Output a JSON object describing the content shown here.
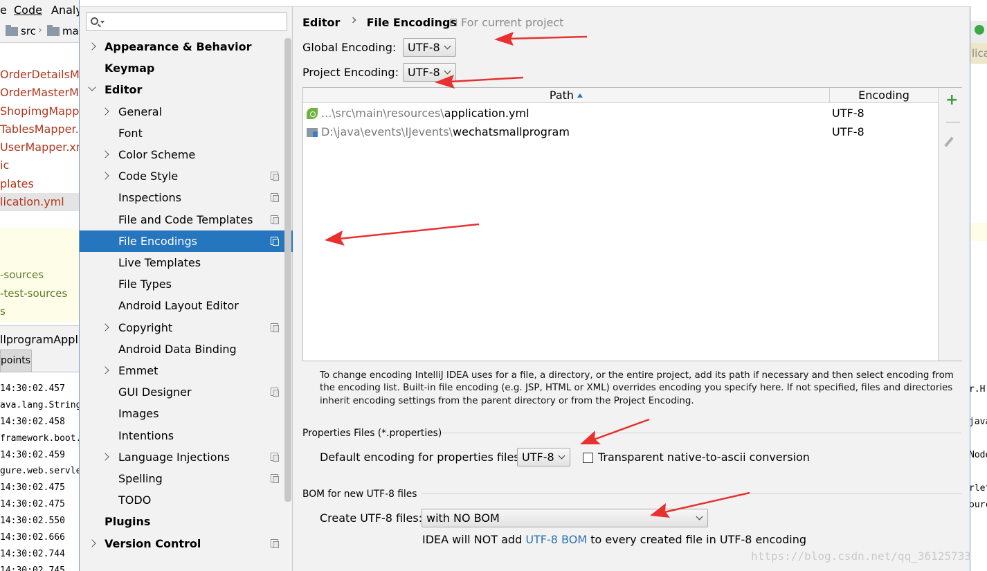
{
  "background_ide": {
    "menu": {
      "item_e": "e",
      "code": "Code",
      "analyze": "Analy"
    },
    "breadcrumb": {
      "src": "src",
      "main": "mai"
    },
    "project_files": [
      {
        "label": "OrderDetailsMa",
        "red": true
      },
      {
        "label": "OrderMasterMa",
        "red": true
      },
      {
        "label": "ShopimgMappe",
        "red": true
      },
      {
        "label": "TablesMapper.x",
        "red": true
      },
      {
        "label": "UserMapper.xm",
        "red": true
      },
      {
        "label": "ic",
        "red": true
      },
      {
        "label": "plates",
        "red": true
      },
      {
        "label": "lication.yml",
        "red": true
      }
    ],
    "yellow_items": [
      "-sources",
      "-test-sources",
      "s"
    ],
    "run_title": "llprogramApplic",
    "run_tab": "points",
    "log_lines": [
      "14:30:02.457",
      "ava.lang.String",
      "14:30:02.458",
      "framework.boot.",
      "14:30:02.459",
      "gure.web.servle",
      "14:30:02.475",
      "14:30:02.475",
      "14:30:02.550",
      "14:30:02.666",
      "14:30:02.744",
      "14:30:02.745"
    ],
    "right_panel": {
      "label": "lica",
      "log_fragments": [
        "r.H",
        "java",
        "Node",
        "rlet",
        "ourc"
      ]
    }
  },
  "settings_nav": {
    "search_placeholder": "",
    "items": [
      {
        "label": "Appearance & Behavior",
        "bold": true,
        "level": 0,
        "arrow": "right",
        "project": false
      },
      {
        "label": "Keymap",
        "bold": true,
        "level": 0,
        "arrow": "none",
        "project": false
      },
      {
        "label": "Editor",
        "bold": true,
        "level": 0,
        "arrow": "down",
        "project": false
      },
      {
        "label": "General",
        "bold": false,
        "level": 1,
        "arrow": "right",
        "project": false
      },
      {
        "label": "Font",
        "bold": false,
        "level": 1,
        "arrow": "none",
        "project": false
      },
      {
        "label": "Color Scheme",
        "bold": false,
        "level": 1,
        "arrow": "right",
        "project": false
      },
      {
        "label": "Code Style",
        "bold": false,
        "level": 1,
        "arrow": "right",
        "project": true
      },
      {
        "label": "Inspections",
        "bold": false,
        "level": 1,
        "arrow": "none",
        "project": true
      },
      {
        "label": "File and Code Templates",
        "bold": false,
        "level": 1,
        "arrow": "none",
        "project": true
      },
      {
        "label": "File Encodings",
        "bold": false,
        "level": 1,
        "arrow": "none",
        "project": true,
        "selected": true
      },
      {
        "label": "Live Templates",
        "bold": false,
        "level": 1,
        "arrow": "none",
        "project": false
      },
      {
        "label": "File Types",
        "bold": false,
        "level": 1,
        "arrow": "none",
        "project": false
      },
      {
        "label": "Android Layout Editor",
        "bold": false,
        "level": 1,
        "arrow": "none",
        "project": false
      },
      {
        "label": "Copyright",
        "bold": false,
        "level": 1,
        "arrow": "right",
        "project": true
      },
      {
        "label": "Android Data Binding",
        "bold": false,
        "level": 1,
        "arrow": "none",
        "project": false
      },
      {
        "label": "Emmet",
        "bold": false,
        "level": 1,
        "arrow": "right",
        "project": false
      },
      {
        "label": "GUI Designer",
        "bold": false,
        "level": 1,
        "arrow": "none",
        "project": true
      },
      {
        "label": "Images",
        "bold": false,
        "level": 1,
        "arrow": "none",
        "project": false
      },
      {
        "label": "Intentions",
        "bold": false,
        "level": 1,
        "arrow": "none",
        "project": false
      },
      {
        "label": "Language Injections",
        "bold": false,
        "level": 1,
        "arrow": "right",
        "project": true
      },
      {
        "label": "Spelling",
        "bold": false,
        "level": 1,
        "arrow": "none",
        "project": true
      },
      {
        "label": "TODO",
        "bold": false,
        "level": 1,
        "arrow": "none",
        "project": false
      },
      {
        "label": "Plugins",
        "bold": true,
        "level": 0,
        "arrow": "none",
        "project": false
      },
      {
        "label": "Version Control",
        "bold": true,
        "level": 0,
        "arrow": "right",
        "project": true
      }
    ]
  },
  "content": {
    "breadcrumb": {
      "parent": "Editor",
      "current": "File Encodings",
      "scope": "For current project"
    },
    "global_encoding": {
      "label": "Global Encoding:",
      "value": "UTF-8"
    },
    "project_encoding": {
      "label": "Project Encoding:",
      "value": "UTF-8"
    },
    "table": {
      "columns": {
        "path": "Path",
        "encoding": "Encoding"
      },
      "rows": [
        {
          "path_prefix": "...\\src\\main\\resources\\",
          "path_name": "application.yml",
          "encoding": "UTF-8"
        },
        {
          "path_prefix": "D:\\java\\events\\IJevents\\",
          "path_name": "wechatsmallprogram",
          "encoding": "UTF-8"
        }
      ]
    },
    "help_text": "To change encoding IntelliJ IDEA uses for a file, a directory, or the entire project, add its path if necessary and then select encoding from the encoding list. Built-in file encoding (e.g. JSP, HTML or XML) overrides encoding you specify here. If not specified, files and directories inherit encoding settings from the parent directory or from the Project Encoding.",
    "properties": {
      "group_title": "Properties Files (*.properties)",
      "default_label": "Default encoding for properties files:",
      "default_value": "UTF-8",
      "native_to_ascii_label": "Transparent native-to-ascii conversion",
      "native_to_ascii_checked": false
    },
    "bom": {
      "group_title": "BOM for new UTF-8 files",
      "create_label": "Create UTF-8 files:",
      "create_value": "with NO BOM",
      "note_before": "IDEA will NOT add ",
      "note_link": "UTF-8 BOM",
      "note_after": " to every created file in UTF-8 encoding"
    }
  },
  "watermark": "https://blog.csdn.net/qq_36125733",
  "colors": {
    "selection": "#2675bf",
    "annotation_arrow": "#e8302e",
    "link": "#2b6fb5"
  }
}
